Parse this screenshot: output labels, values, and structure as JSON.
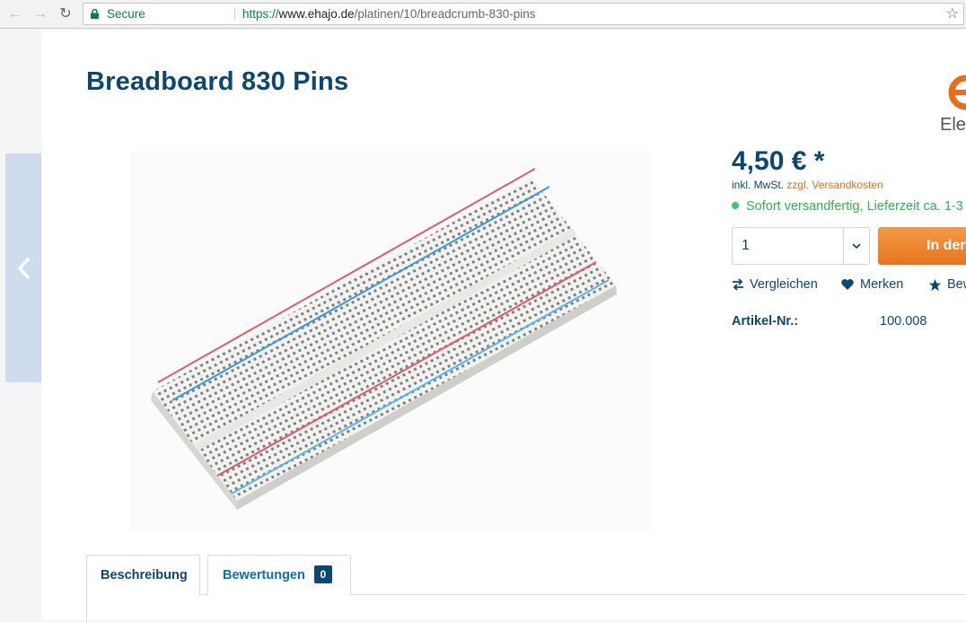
{
  "browser": {
    "secure_label": "Secure",
    "url_scheme": "https://",
    "url_host": "www.ehajo.de",
    "url_path": "/platinen/10/breadcrumb-830-pins"
  },
  "product": {
    "title": "Breadboard 830 Pins",
    "price": "4,50 € *",
    "tax_text": "inkl. MwSt.",
    "shipping_link": "zzgl. Versandkosten",
    "delivery": "Sofort versandfertig, Lieferzeit ca. 1-3",
    "quantity": "1",
    "buy_label": "In den",
    "compare_label": "Vergleichen",
    "wishlist_label": "Merken",
    "rate_label": "Bew",
    "article_label": "Artikel-Nr.:",
    "article_value": "100.008"
  },
  "logo": {
    "text": "Ele"
  },
  "tabs": [
    {
      "label": "Beschreibung"
    },
    {
      "label": "Bewertungen",
      "badge": "0"
    }
  ],
  "colors": {
    "primary": "#0d4670",
    "accent": "#e86c1c",
    "success": "#2fb350",
    "link": "#0d6fb8"
  }
}
